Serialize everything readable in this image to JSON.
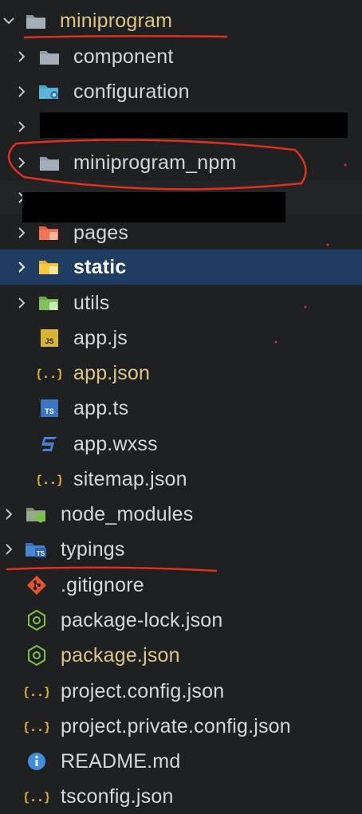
{
  "explorer": {
    "root": {
      "label": "miniprogram",
      "icon": "folder-icon",
      "expanded": true
    },
    "children": [
      {
        "label": "component",
        "icon": "folder-icon"
      },
      {
        "label": "configuration",
        "icon": "folder-config-icon"
      },
      {
        "label": "",
        "icon": "folder-icon",
        "redacted": true
      },
      {
        "label": "miniprogram_npm",
        "icon": "folder-icon"
      },
      {
        "label": "",
        "icon": "folder-icon",
        "redacted": true
      },
      {
        "label": "pages",
        "icon": "folder-pages-icon"
      },
      {
        "label": "static",
        "icon": "folder-static-icon",
        "selected": true
      },
      {
        "label": "utils",
        "icon": "folder-utils-icon"
      }
    ],
    "files": [
      {
        "label": "app.js",
        "icon": "js-file-icon"
      },
      {
        "label": "app.json",
        "icon": "json-file-icon",
        "modified": true
      },
      {
        "label": "app.ts",
        "icon": "ts-file-icon"
      },
      {
        "label": "app.wxss",
        "icon": "css-file-icon"
      },
      {
        "label": "sitemap.json",
        "icon": "json-file-icon"
      }
    ],
    "top_folders": [
      {
        "label": "node_modules",
        "icon": "node-modules-icon"
      },
      {
        "label": "typings",
        "icon": "typings-folder-icon"
      }
    ],
    "top_files": [
      {
        "label": ".gitignore",
        "icon": "git-icon"
      },
      {
        "label": "package-lock.json",
        "icon": "npm-file-icon"
      },
      {
        "label": "package.json",
        "icon": "npm-file-icon",
        "modified": true
      },
      {
        "label": "project.config.json",
        "icon": "json-file-icon"
      },
      {
        "label": "project.private.config.json",
        "icon": "json-file-icon"
      },
      {
        "label": "README.md",
        "icon": "info-icon"
      },
      {
        "label": "tsconfig.json",
        "icon": "json-file-icon"
      }
    ]
  },
  "colors": {
    "background": "#1f2022",
    "selected_row": "#1f3d62",
    "text": "#d7d7d7",
    "modified_text": "#dcc585",
    "annotation": "#e0301e"
  }
}
